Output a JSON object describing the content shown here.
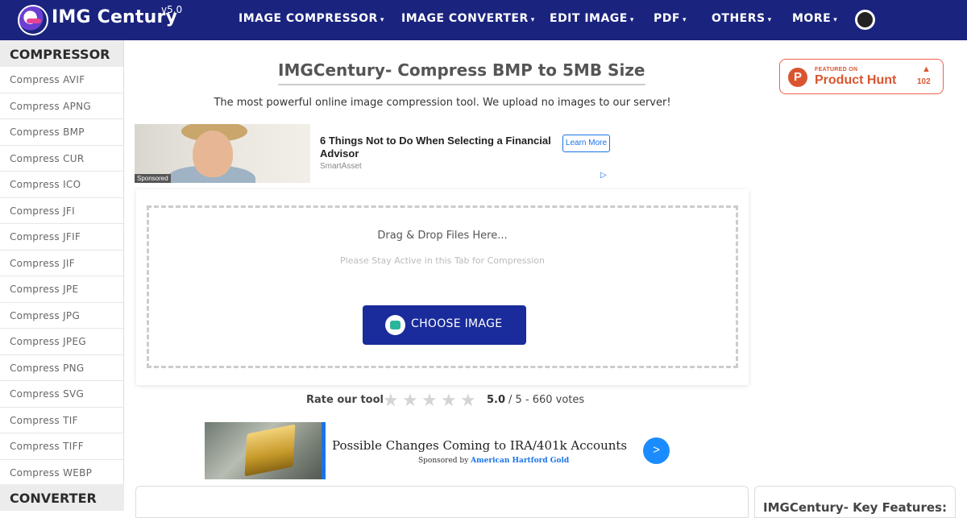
{
  "header": {
    "brand": "IMG Century",
    "version": "v5.0",
    "nav": [
      {
        "label": "IMAGE COMPRESSOR",
        "caret": "▾"
      },
      {
        "label": "IMAGE CONVERTER",
        "caret": "▾"
      },
      {
        "label": "EDIT IMAGE",
        "caret": "▾"
      },
      {
        "label": "PDF",
        "caret": "▾"
      },
      {
        "label": "OTHERS",
        "caret": "▾"
      },
      {
        "label": "MORE",
        "caret": "▾"
      }
    ]
  },
  "sidebar": {
    "heading": "COMPRESSOR",
    "items": [
      "Compress AVIF",
      "Compress APNG",
      "Compress BMP",
      "Compress CUR",
      "Compress ICO",
      "Compress JFI",
      "Compress JFIF",
      "Compress JIF",
      "Compress JPE",
      "Compress JPG",
      "Compress JPEG",
      "Compress PNG",
      "Compress SVG",
      "Compress TIF",
      "Compress TIFF",
      "Compress WEBP"
    ],
    "next_heading": "CONVERTER"
  },
  "main": {
    "title": "IMGCentury- Compress BMP to 5MB Size",
    "subtitle": "The most powerful online image compression tool. We upload no images to our server!",
    "drop_text": "Drag & Drop Files Here...",
    "stay_text": "Please Stay Active in this Tab for Compression",
    "choose_button": "CHOOSE IMAGE",
    "rating": {
      "label": "Rate our tool",
      "stars": 5,
      "score": "5.0",
      "votes_text": "/ 5 - 660 votes"
    }
  },
  "product_hunt": {
    "featured": "FEATURED ON",
    "name": "Product Hunt",
    "arrow": "▲",
    "count": "102"
  },
  "ad1": {
    "title": "6 Things Not to Do When Selecting a Financial Advisor",
    "source": "SmartAsset",
    "button": "Learn More",
    "sponsored": "Sponsored"
  },
  "ad2": {
    "title": "Possible Changes Coming to IRA/401k Accounts",
    "sponsored_prefix": "Sponsored by ",
    "sponsor": "American Hartford Gold",
    "arrow": ">"
  },
  "features_title": "IMGCentury- Key Features:",
  "colors": {
    "nav_bg": "#1a237e",
    "button_bg": "#1a2b9b",
    "product_hunt": "#da552f"
  }
}
